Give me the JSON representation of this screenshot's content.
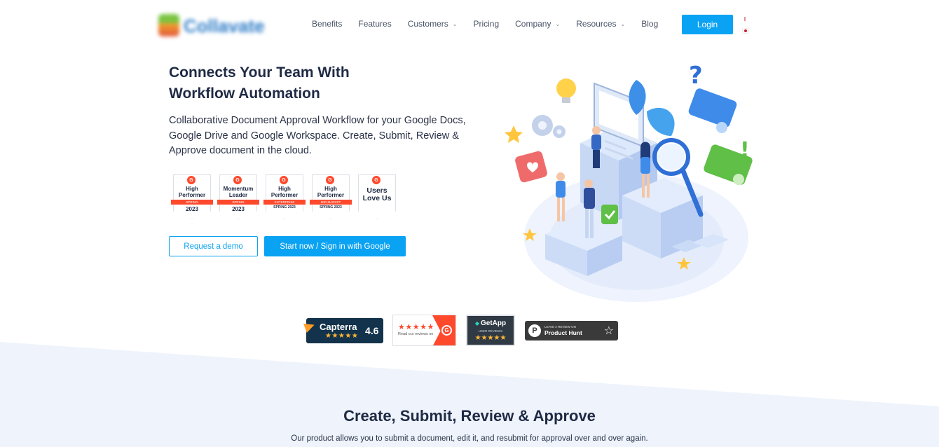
{
  "header": {
    "logo_text": "Collavate",
    "nav": [
      {
        "label": "Benefits",
        "has_caret": false
      },
      {
        "label": "Features",
        "has_caret": false
      },
      {
        "label": "Customers",
        "has_caret": true
      },
      {
        "label": "Pricing",
        "has_caret": false
      },
      {
        "label": "Company",
        "has_caret": true
      },
      {
        "label": "Resources",
        "has_caret": true
      },
      {
        "label": "Blog",
        "has_caret": false
      }
    ],
    "login_label": "Login",
    "languages": [
      "uk-flag-icon",
      "japan-flag-icon"
    ]
  },
  "hero": {
    "title_line1": "Connects Your Team With",
    "title_line2": "Workflow Automation",
    "subtitle": "Collaborative Document Approval Workflow for your Google Docs, Google Drive and Google Workspace. Create, Submit, Review & Approve document in the cloud.",
    "badges": [
      {
        "title": "High Performer",
        "ribbon": "SPRING",
        "year": "2023"
      },
      {
        "title": "Momentum Leader",
        "ribbon": "SPRING",
        "year": "2023"
      },
      {
        "title": "High Performer",
        "ribbon": "Enterprise",
        "year": "SPRING 2023"
      },
      {
        "title": "High Performer",
        "ribbon": "Mid-Market",
        "year": "SPRING 2023"
      },
      {
        "title": "Users Love Us"
      }
    ],
    "g2_mark": "G",
    "demo_button": "Request a demo",
    "start_button": "Start now / Sign in with Google"
  },
  "reviews": {
    "capterra": {
      "name": "Capterra",
      "stars": "★★★★★",
      "score": "4.6"
    },
    "g2": {
      "stars": "★★★★★",
      "text": "Read our reviews on",
      "logo": "G"
    },
    "getapp": {
      "name": "GetApp",
      "sub": "USER REVIEWS",
      "stars": "★★★★★"
    },
    "producthunt": {
      "small": "LEAVE A REVIEW ON",
      "name": "Product Hunt",
      "logo": "P",
      "star": "☆"
    }
  },
  "section": {
    "title": "Create, Submit, Review & Approve",
    "subtitle": "Our product allows you to submit a document, edit it, and resubmit for approval over and over again."
  },
  "colors": {
    "primary": "#0aa2f2",
    "heading": "#1f2a44",
    "g2_red": "#ff492c",
    "capterra_navy": "#12334b",
    "section_bg": "#eef3fc"
  }
}
